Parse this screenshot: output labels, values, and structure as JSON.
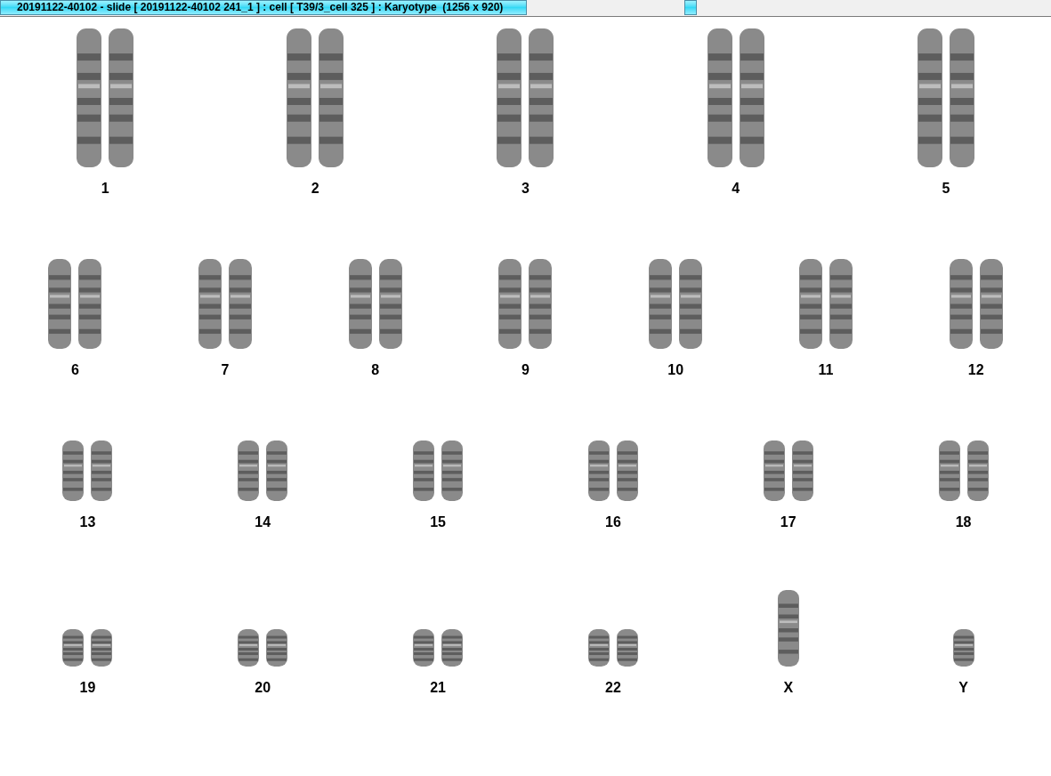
{
  "window": {
    "title": "20191122-40102 - slide [ 20191122-40102 241_1 ] : cell [ T39/3_cell 325 ] : Karyotype  (1256 x 920)"
  },
  "karyotype": {
    "rows": [
      {
        "items": [
          {
            "label": "1",
            "kind": "pair"
          },
          {
            "label": "2",
            "kind": "pair"
          },
          {
            "label": "3",
            "kind": "pair"
          },
          {
            "label": "4",
            "kind": "pair"
          },
          {
            "label": "5",
            "kind": "pair"
          }
        ]
      },
      {
        "items": [
          {
            "label": "6",
            "kind": "pair"
          },
          {
            "label": "7",
            "kind": "pair"
          },
          {
            "label": "8",
            "kind": "pair"
          },
          {
            "label": "9",
            "kind": "pair"
          },
          {
            "label": "10",
            "kind": "pair"
          },
          {
            "label": "11",
            "kind": "pair"
          },
          {
            "label": "12",
            "kind": "pair"
          }
        ]
      },
      {
        "items": [
          {
            "label": "13",
            "kind": "pair"
          },
          {
            "label": "14",
            "kind": "pair"
          },
          {
            "label": "15",
            "kind": "pair"
          },
          {
            "label": "16",
            "kind": "pair"
          },
          {
            "label": "17",
            "kind": "pair"
          },
          {
            "label": "18",
            "kind": "pair"
          }
        ]
      },
      {
        "items": [
          {
            "label": "19",
            "kind": "pair"
          },
          {
            "label": "20",
            "kind": "pair"
          },
          {
            "label": "21",
            "kind": "pair"
          },
          {
            "label": "22",
            "kind": "pair"
          },
          {
            "label": "X",
            "kind": "single"
          },
          {
            "label": "Y",
            "kind": "single"
          }
        ]
      }
    ]
  }
}
